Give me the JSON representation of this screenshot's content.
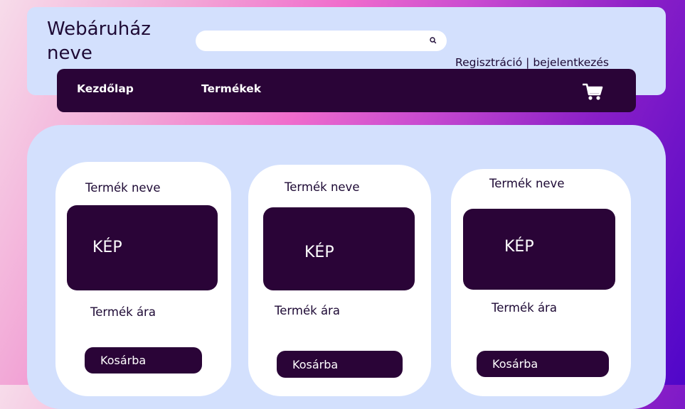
{
  "header": {
    "store_name": "Webáruház neve",
    "search_placeholder": "",
    "auth_register": "Regisztráció",
    "auth_separator": "|",
    "auth_login": "bejelentkezés"
  },
  "nav": {
    "items": [
      {
        "label": "Kezdőlap"
      },
      {
        "label": "Termékek"
      }
    ]
  },
  "products": [
    {
      "name": "Termék neve",
      "image_label": "KÉP",
      "price": "Termék ára",
      "button": "Kosárba"
    },
    {
      "name": "Termék neve",
      "image_label": "KÉP",
      "price": "Termék ára",
      "button": "Kosárba"
    },
    {
      "name": "Termék neve",
      "image_label": "KÉP",
      "price": "Termék ára",
      "button": "Kosárba"
    }
  ],
  "icons": {
    "search": "search-icon",
    "cart": "cart-icon"
  },
  "colors": {
    "panel": "#d3e0fd",
    "dark": "#2a0437",
    "card": "#ffffff",
    "text": "#1e0a35"
  }
}
